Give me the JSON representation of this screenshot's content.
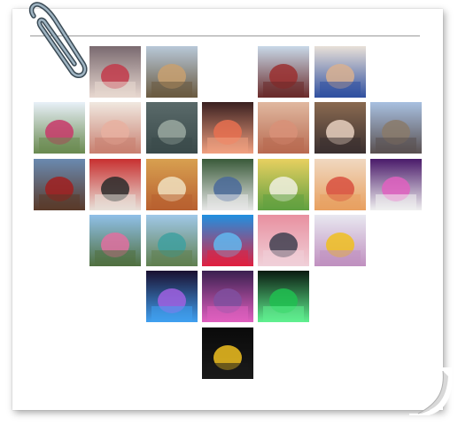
{
  "collage": {
    "shape": "heart",
    "columns": 7,
    "rows": 7,
    "tiles": [
      {
        "r": 0,
        "c": 1,
        "icon": "drink-cup-photo",
        "colors": [
          "#7a6a70",
          "#c23a4a",
          "#e8d8d0"
        ]
      },
      {
        "r": 0,
        "c": 2,
        "icon": "palace-building-photo",
        "colors": [
          "#b8c8d8",
          "#c8a070",
          "#6a5a40"
        ]
      },
      {
        "r": 0,
        "c": 4,
        "icon": "red-church-photo",
        "colors": [
          "#c8d8e8",
          "#9a3030",
          "#6a2a2a"
        ]
      },
      {
        "r": 0,
        "c": 5,
        "icon": "man-portrait-photo",
        "colors": [
          "#e8e0d8",
          "#d8b090",
          "#3050a0"
        ]
      },
      {
        "r": 1,
        "c": 0,
        "icon": "swing-ride-photo",
        "colors": [
          "#e8f0f8",
          "#c83a6a",
          "#6a8a50"
        ]
      },
      {
        "r": 1,
        "c": 1,
        "icon": "dessert-cups-photo",
        "colors": [
          "#f0e8e0",
          "#e8b0a0",
          "#c88070"
        ]
      },
      {
        "r": 1,
        "c": 2,
        "icon": "tunnel-ceiling-photo",
        "colors": [
          "#5a6a6a",
          "#9aa8a0",
          "#3a4a4a"
        ]
      },
      {
        "r": 1,
        "c": 3,
        "icon": "iced-drinks-photo",
        "colors": [
          "#3a2020",
          "#e87050",
          "#f0a080"
        ]
      },
      {
        "r": 1,
        "c": 4,
        "icon": "hands-table-photo",
        "colors": [
          "#e0b8a0",
          "#d89078",
          "#b86a50"
        ]
      },
      {
        "r": 1,
        "c": 5,
        "icon": "woman-smiling-photo",
        "colors": [
          "#8a6a50",
          "#e8d0c0",
          "#3a3030"
        ]
      },
      {
        "r": 1,
        "c": 6,
        "icon": "clock-tower-photo",
        "colors": [
          "#a8c0e0",
          "#8a7a6a",
          "#5a5050"
        ]
      },
      {
        "r": 2,
        "c": 0,
        "icon": "bottle-drink-photo",
        "colors": [
          "#6a8ab0",
          "#a02020",
          "#5a3a2a"
        ]
      },
      {
        "r": 2,
        "c": 1,
        "icon": "card-machine-photo",
        "colors": [
          "#c83030",
          "#2a2a2a",
          "#e8e0d8"
        ]
      },
      {
        "r": 2,
        "c": 2,
        "icon": "food-bowl-photo",
        "colors": [
          "#d8a050",
          "#f0e0c0",
          "#b86030"
        ]
      },
      {
        "r": 2,
        "c": 3,
        "icon": "jeans-sneakers-photo",
        "colors": [
          "#3a5a3a",
          "#4a6a9a",
          "#e8e8e8"
        ]
      },
      {
        "r": 2,
        "c": 4,
        "icon": "tofu-dish-photo",
        "colors": [
          "#e8d060",
          "#f0f0e0",
          "#60a040"
        ]
      },
      {
        "r": 2,
        "c": 5,
        "icon": "pizza-slice-photo",
        "colors": [
          "#f0d8c0",
          "#d85040",
          "#e8a060"
        ]
      },
      {
        "r": 2,
        "c": 6,
        "icon": "wedding-stage-photo",
        "colors": [
          "#4a1a6a",
          "#e060c0",
          "#f0f0f0"
        ]
      },
      {
        "r": 3,
        "c": 1,
        "icon": "ferris-wheel-photo",
        "colors": [
          "#90c0e8",
          "#e070a0",
          "#507040"
        ]
      },
      {
        "r": 3,
        "c": 2,
        "icon": "teal-pavilion-photo",
        "colors": [
          "#a0c8e8",
          "#40a0a0",
          "#608050"
        ]
      },
      {
        "r": 3,
        "c": 3,
        "icon": "red-flower-photo",
        "colors": [
          "#2090e0",
          "#60b8f0",
          "#e02040"
        ]
      },
      {
        "r": 3,
        "c": 4,
        "icon": "mall-girl-photo",
        "colors": [
          "#e890a0",
          "#404050",
          "#f0d0d8"
        ]
      },
      {
        "r": 3,
        "c": 5,
        "icon": "yellow-figures-photo",
        "colors": [
          "#e8e8f0",
          "#f0c020",
          "#c090c0"
        ]
      },
      {
        "r": 4,
        "c": 2,
        "icon": "night-lights-photo",
        "colors": [
          "#1a1030",
          "#a060e0",
          "#40a0f0"
        ]
      },
      {
        "r": 4,
        "c": 3,
        "icon": "neon-sign-photo",
        "colors": [
          "#3a2050",
          "#8050a0",
          "#e060c0"
        ]
      },
      {
        "r": 4,
        "c": 4,
        "icon": "green-light-curtain-photo",
        "colors": [
          "#0a1a10",
          "#20c050",
          "#60f090"
        ]
      },
      {
        "r": 5,
        "c": 3,
        "icon": "moon-silhouette-photo",
        "colors": [
          "#0a0a0a",
          "#f0c020",
          "#1a1a1a"
        ]
      }
    ]
  }
}
